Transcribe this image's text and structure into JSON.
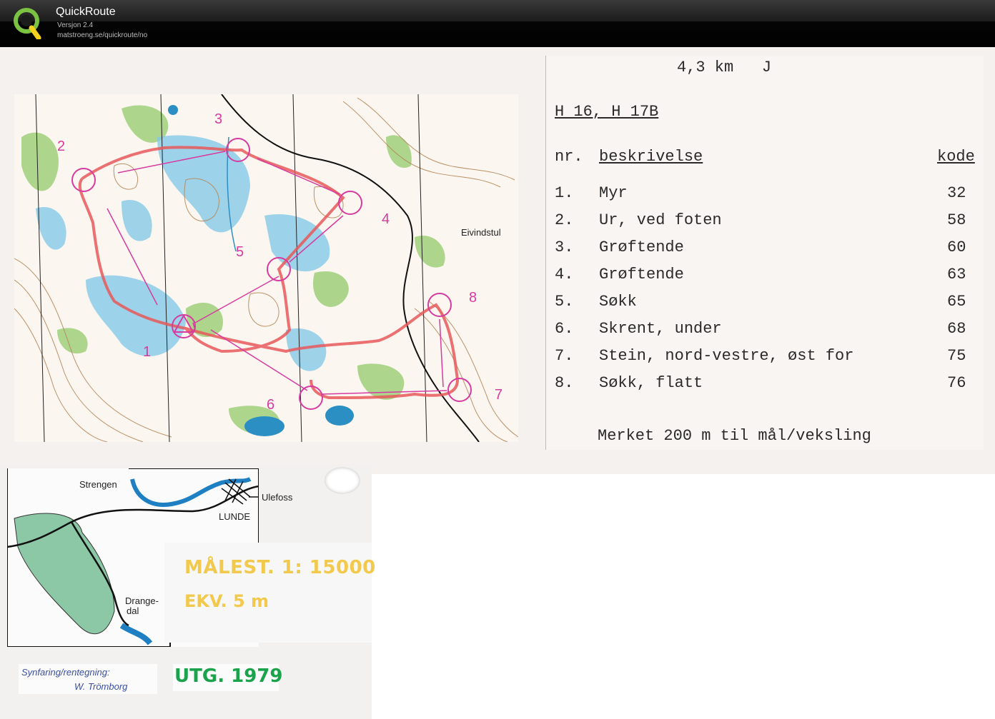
{
  "app": {
    "title": "QuickRoute",
    "version": "Versjon 2.4",
    "url": "matstroeng.se/quickroute/no"
  },
  "map": {
    "place_label": "Eivindstul",
    "control_numbers": [
      "1",
      "2",
      "3",
      "4",
      "5",
      "6",
      "7",
      "8"
    ]
  },
  "description": {
    "distance": "4,3 km   J",
    "course": "H 16, H 17B",
    "header_nr": "nr.",
    "header_desc": "beskrivelse",
    "header_code": "kode",
    "rows": [
      {
        "nr": "1.",
        "desc": "Myr",
        "code": "32"
      },
      {
        "nr": "2.",
        "desc": "Ur, ved foten",
        "code": "58"
      },
      {
        "nr": "3.",
        "desc": "Grøftende",
        "code": "60"
      },
      {
        "nr": "4.",
        "desc": "Grøftende",
        "code": "63"
      },
      {
        "nr": "5.",
        "desc": "Søkk",
        "code": "65"
      },
      {
        "nr": "6.",
        "desc": "Skrent, under",
        "code": "68"
      },
      {
        "nr": "7.",
        "desc": "Stein, nord-vestre, øst for",
        "code": "75"
      },
      {
        "nr": "8.",
        "desc": "Søkk, flatt",
        "code": "76"
      }
    ],
    "footer": "Merket 200 m til mål/veksling"
  },
  "inset_map": {
    "labels": {
      "strengen": "Strengen",
      "ulefoss": "Ulefoss",
      "lunde": "LUNDE",
      "drangedal_1": "Drange-",
      "drangedal_2": "dal"
    }
  },
  "legend": {
    "scale": "MÅLEST. 1: 15000",
    "ekv": "EKV.  5 m",
    "credit_1": "Synfaring/rentegning:",
    "credit_2": "W. Trömborg",
    "utg": "UTG. 1979"
  },
  "colors": {
    "route": "#e8585a",
    "controls": "#d63ba0",
    "water": "#5ab9e0",
    "vegetation": "#88c267",
    "contour": "#b5875a"
  }
}
